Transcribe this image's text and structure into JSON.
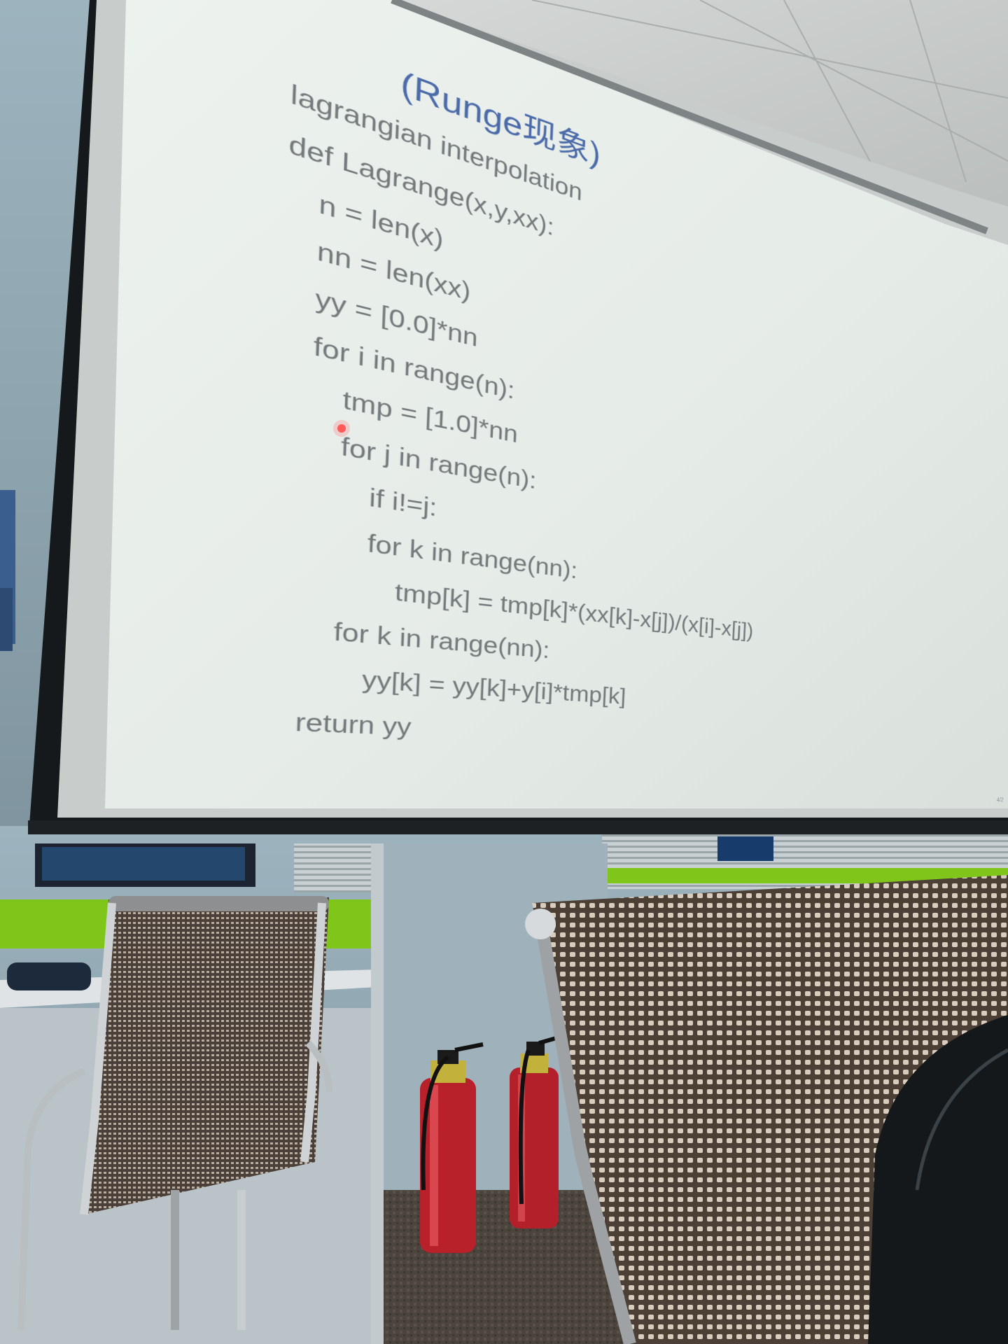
{
  "slide": {
    "header": "(Runge现象)",
    "code_lines": [
      "lagrangian interpolation",
      "def Lagrange(x,y,xx):",
      "n = len(x)",
      "nn = len(xx)",
      "yy = [0.0]*nn",
      "for i in range(n):",
      "tmp = [1.0]*nn",
      "for j in range(n):",
      "if i!=j:",
      "for k in range(nn):",
      "tmp[k] = tmp[k]*(xx[k]-x[j])/(x[i]-x[j])",
      "for k in range(nn):",
      "yy[k] = yy[k]+y[i]*tmp[k]",
      "return yy"
    ],
    "page_number": "4/2"
  },
  "colors": {
    "screen": "#e6ece8",
    "screen_frame": "#16191b",
    "code_text": "#73787a",
    "header_text": "#4a6aa8",
    "wall": "#8ea8b4",
    "extinguisher": "#b8202a",
    "cubicle_green": "#7fc51a"
  }
}
